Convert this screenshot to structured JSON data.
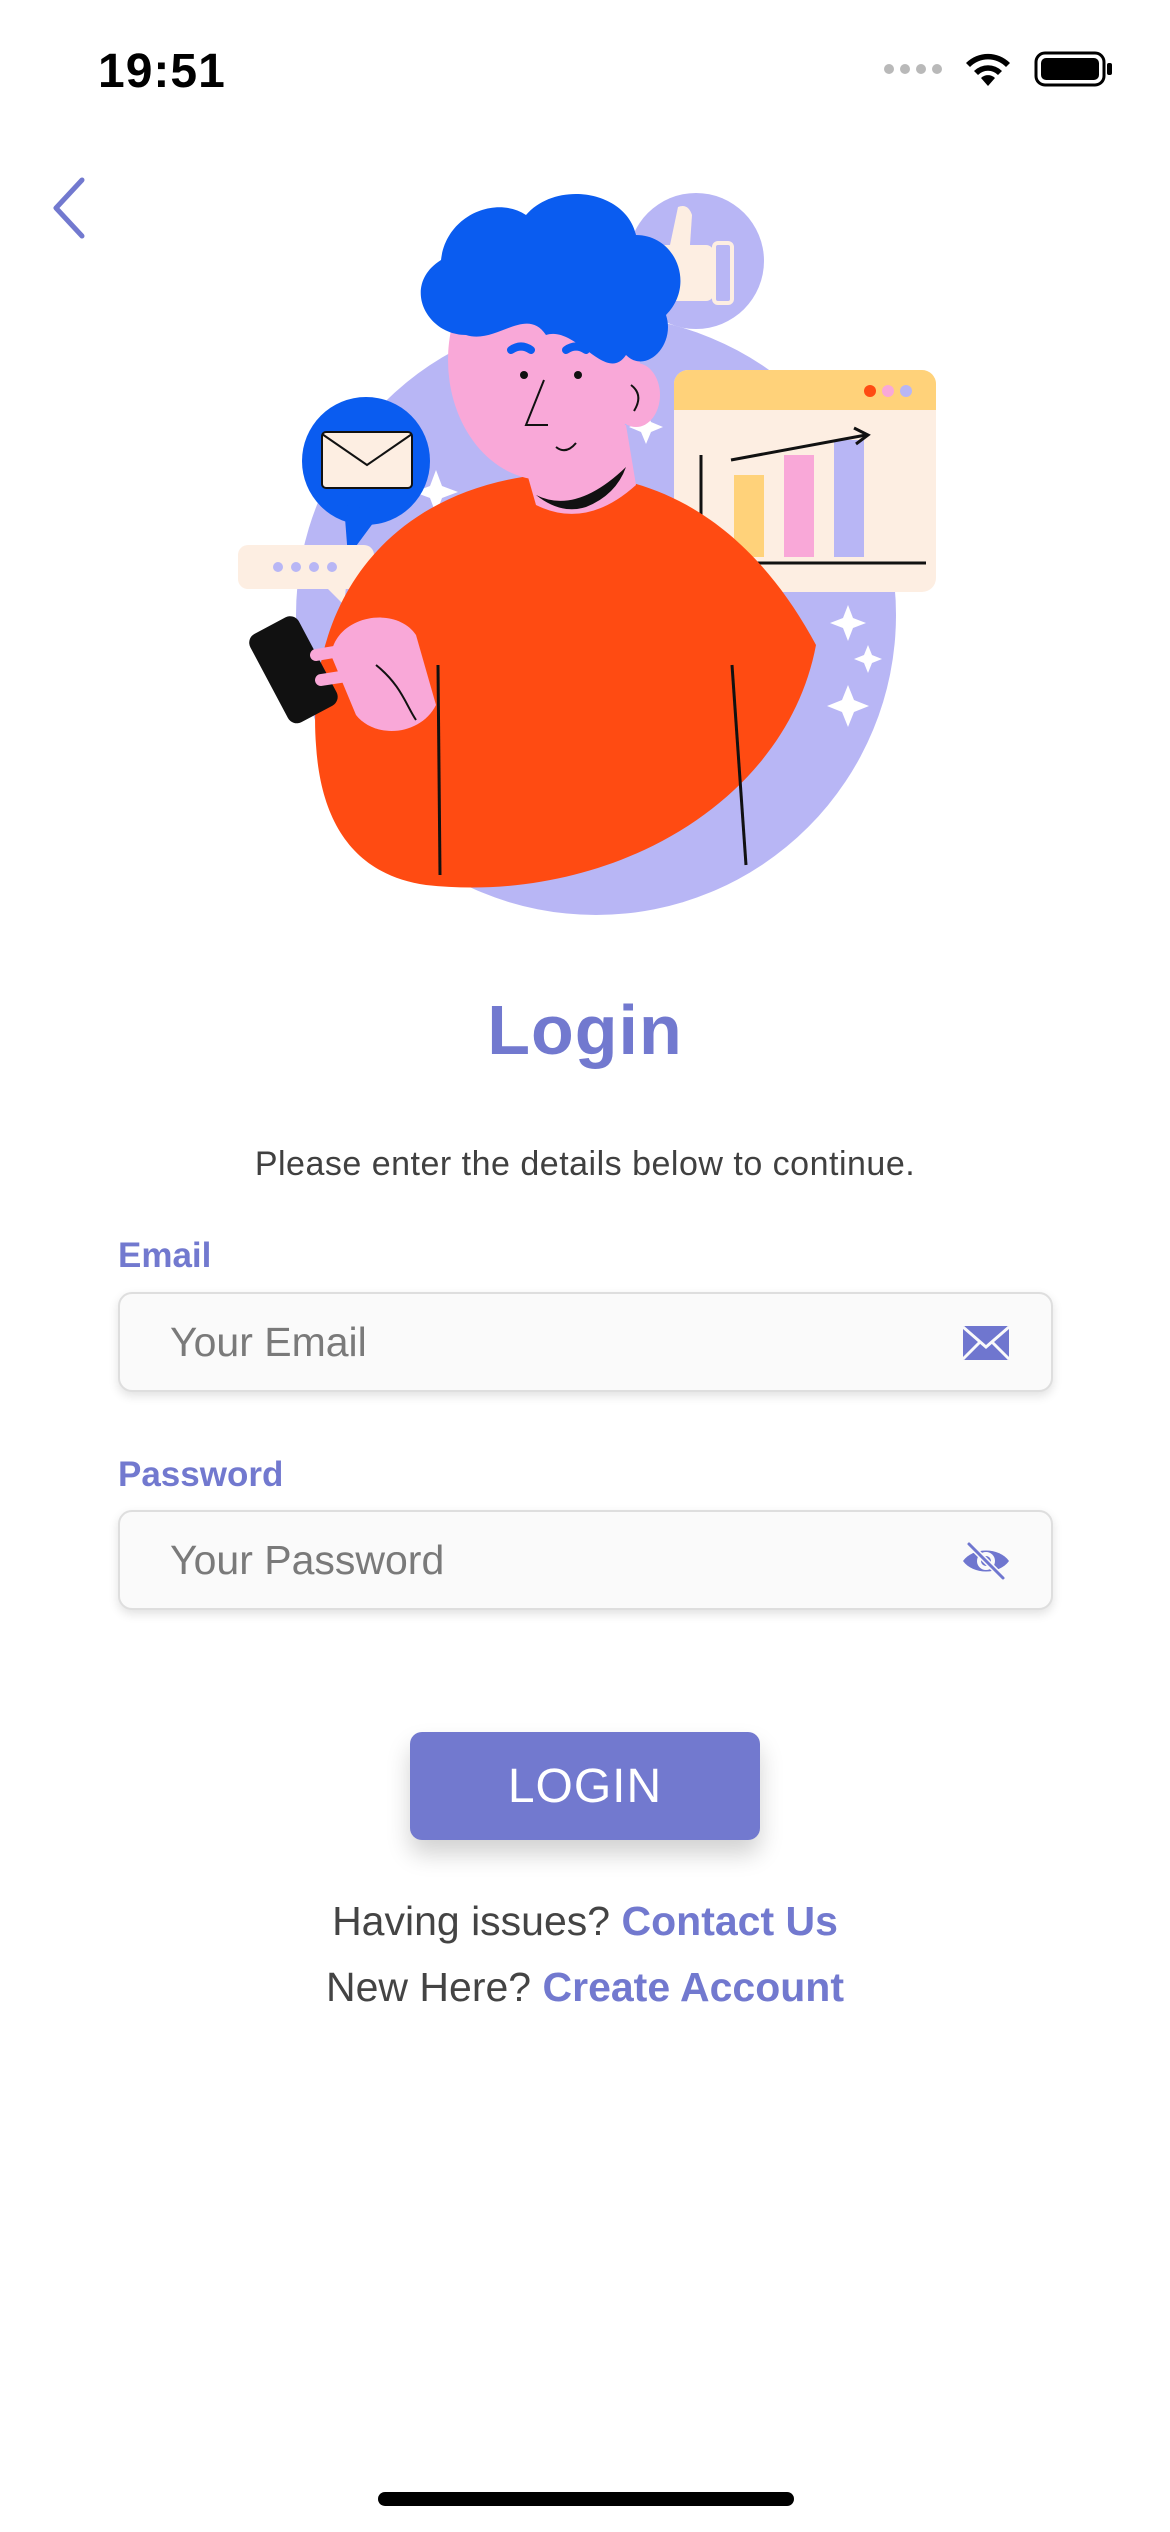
{
  "status_bar": {
    "time": "19:51"
  },
  "header": {
    "back_icon": "chevron-left-icon"
  },
  "hero": {
    "illustration": "person-with-phone-illustration"
  },
  "title": "Login",
  "subtitle": "Please enter the details below to continue.",
  "form": {
    "email": {
      "label": "Email",
      "placeholder": "Your Email",
      "value": "",
      "icon": "envelope-icon"
    },
    "password": {
      "label": "Password",
      "placeholder": "Your Password",
      "value": "",
      "icon": "eye-slash-icon"
    }
  },
  "login_button": {
    "label": "LOGIN"
  },
  "help": {
    "issues_text": "Having issues?",
    "contact_link": "Contact Us",
    "new_text": "New Here?",
    "create_link": "Create Account"
  },
  "colors": {
    "accent": "#7279cf",
    "hero_orange": "#ff4b12",
    "hero_blue": "#0a5cf0",
    "hero_skin": "#f9a8d8"
  }
}
